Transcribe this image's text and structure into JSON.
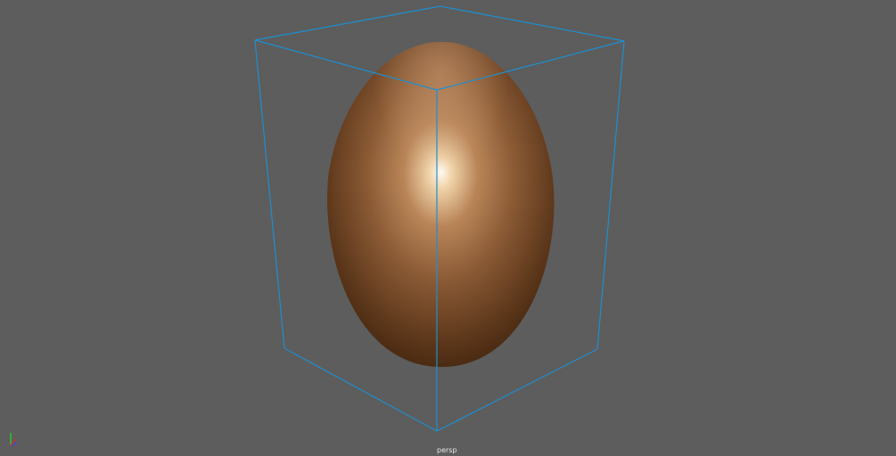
{
  "viewport": {
    "camera_label": "persp",
    "background_color": "#5d5d5d",
    "bounding_box_color": "#1f8fd0",
    "object": "egg",
    "object_color": "#8a5a35"
  },
  "axis_gizmo": {
    "x_color": "#d03030",
    "y_color": "#30c030",
    "z_color": "#3050e0"
  }
}
